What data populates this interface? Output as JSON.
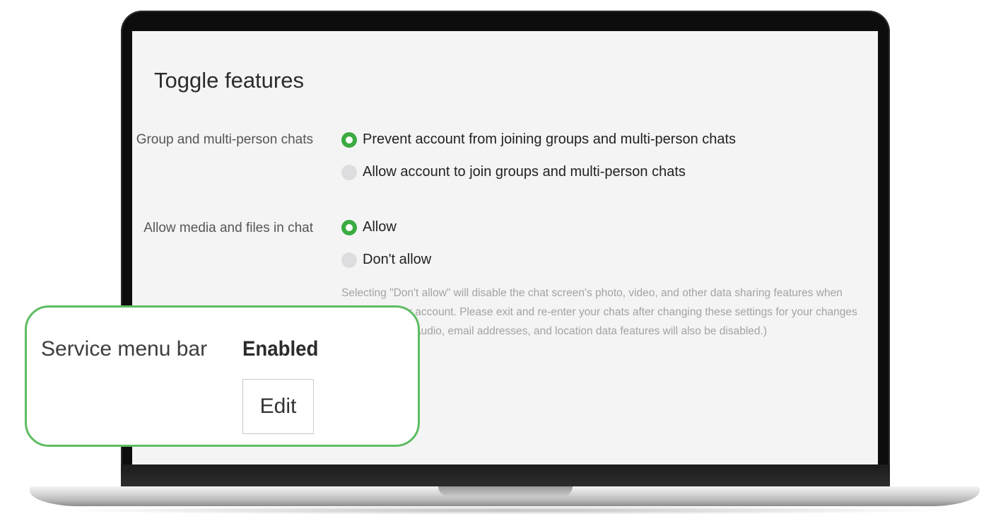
{
  "section": {
    "title": "Toggle features"
  },
  "settings": [
    {
      "label": "Group and multi-person chats",
      "options": [
        {
          "label": "Prevent account from joining groups and multi-person chats",
          "checked": true
        },
        {
          "label": "Allow account to join groups and multi-person chats",
          "checked": false
        }
      ]
    },
    {
      "label": "Allow media and files in chat",
      "options": [
        {
          "label": "Allow",
          "checked": true
        },
        {
          "label": "Don't allow",
          "checked": false
        }
      ],
      "help": "Selecting \"Don't allow\" will disable the chat screen's photo, video, and other data sharing features when used with your account. Please exit and re-enter your chats after changing these settings for your changes to take effect. (Audio, email addresses, and location data features will also be disabled.)"
    }
  ],
  "callout": {
    "label": "Service menu bar",
    "value": "Enabled",
    "edit_label": "Edit"
  },
  "colors": {
    "accent": "#3bab42",
    "callout_border": "#5ebc63"
  }
}
